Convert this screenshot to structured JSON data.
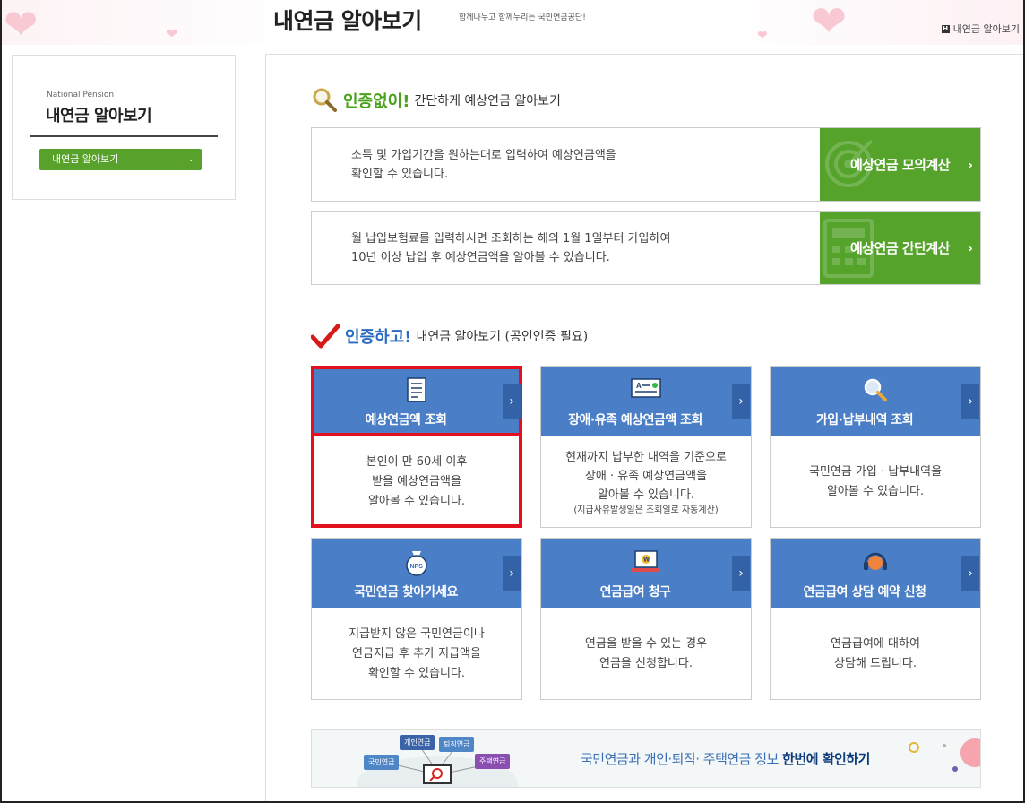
{
  "header": {
    "title": "내연금 알아보기",
    "slogan": "함께나누고 함께누리는 국민연금공단!",
    "breadcrumb": "내연금 알아보기"
  },
  "sidebar": {
    "subtitle": "National Pension",
    "title": "내연금 알아보기",
    "menu_button": "내연금 알아보기"
  },
  "section1": {
    "accent": "인증없이!",
    "rest": "간단하게 예상연금 알아보기",
    "items": [
      {
        "desc_line1": "소득 및 가입기간을 원하는대로 입력하여 예상연금액을",
        "desc_line2": "확인할 수 있습니다.",
        "button": "예상연금 모의계산"
      },
      {
        "desc_line1": "월 납입보험료를 입력하시면 조회하는 해의 1월 1일부터 가입하여",
        "desc_line2": "10년 이상 납입 후 예상연금액을 알아볼 수 있습니다.",
        "button": "예상연금 간단계산"
      }
    ]
  },
  "section2": {
    "accent": "인증하고!",
    "rest": "내연금 알아보기 (공인인증 필요)",
    "cards": [
      {
        "title": "예상연금액 조회",
        "lines": [
          "본인이 만 60세 이후",
          "받을 예상연금액을",
          "알아볼 수 있습니다."
        ],
        "note": "",
        "icon": "document-icon"
      },
      {
        "title": "장애·유족 예상연금액 조회",
        "lines": [
          "현재까지 납부한 내역을 기준으로",
          "장애 · 유족 예상연금액을",
          "알아볼 수 있습니다."
        ],
        "note": "(지급사유발생일은 조회일로 자동계산)",
        "icon": "id-card-icon"
      },
      {
        "title": "가입·납부내역 조회",
        "lines": [
          "국민연금 가입 · 납부내역을",
          "알아볼 수 있습니다."
        ],
        "note": "",
        "icon": "magnifier-icon"
      },
      {
        "title": "국민연금 찾아가세요",
        "lines": [
          "지급받지 않은 국민연금이나",
          "연금지급 후 추가 지급액을",
          "확인할 수 있습니다."
        ],
        "note": "",
        "icon": "nps-pouch-icon"
      },
      {
        "title": "연금급여 청구",
        "lines": [
          "연금을 받을 수 있는 경우",
          "연금을 신청합니다."
        ],
        "note": "",
        "icon": "laptop-won-icon"
      },
      {
        "title": "연금급여 상담 예약 신청",
        "lines": [
          "연금급여에 대하여",
          "상담해 드립니다."
        ],
        "note": "",
        "icon": "headset-icon"
      }
    ]
  },
  "banner": {
    "text_light": "국민연금과 개인·퇴직· 주택연금 정보 ",
    "text_bold": "한번에 확인하기",
    "tags": [
      "국민연금",
      "개인연금",
      "퇴직연금",
      "주택연금"
    ]
  },
  "colors": {
    "green": "#55a32a",
    "blue": "#4a7ec6",
    "highlight": "#e3101e"
  }
}
